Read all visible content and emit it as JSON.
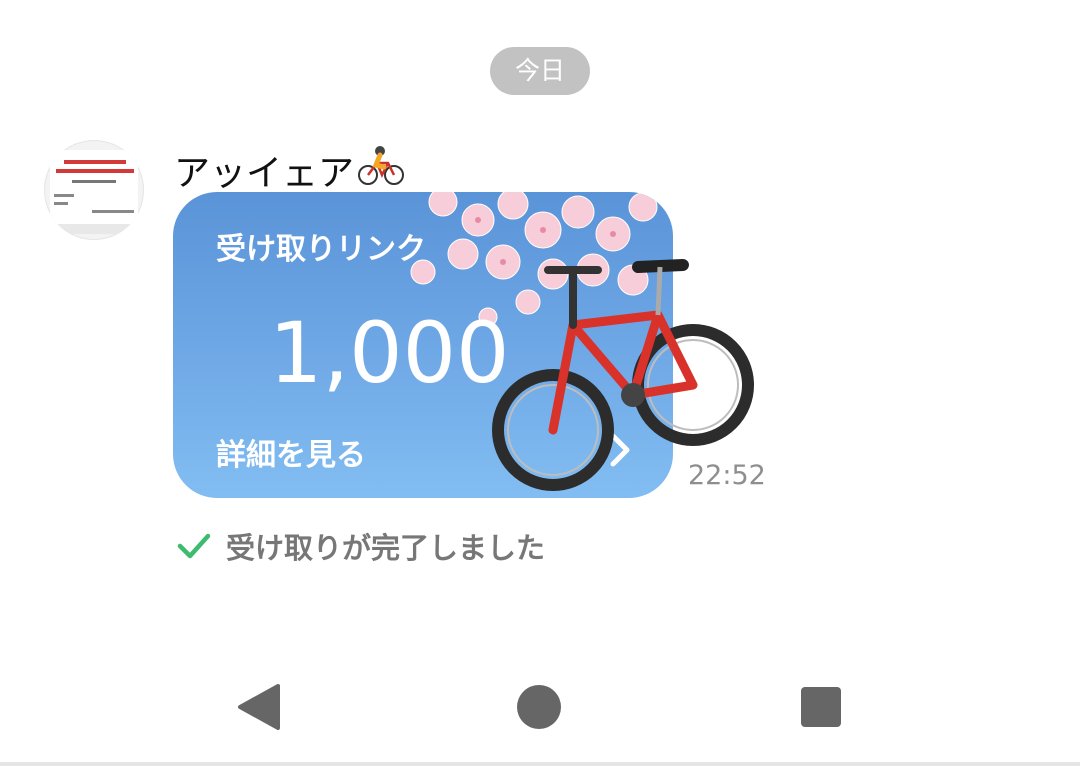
{
  "date_separator": "今日",
  "message": {
    "sender_name": "アッイェア",
    "sender_emoji": "🚴",
    "card": {
      "title": "受け取りリンク",
      "amount": "1,000",
      "details_label": "詳細を見る",
      "chevron_icon": "chevron-right-icon"
    },
    "time": "22:52",
    "status_text": "受け取りが完了しました",
    "status_icon": "check-icon",
    "status_color": "#3dbb6e"
  },
  "navbar": {
    "back": "back-triangle-icon",
    "home": "home-circle-icon",
    "recents": "recents-square-icon"
  },
  "colors": {
    "card_top": "#5a94d8",
    "card_bottom": "#82bdf2",
    "date_pill": "#c2c2c2"
  }
}
